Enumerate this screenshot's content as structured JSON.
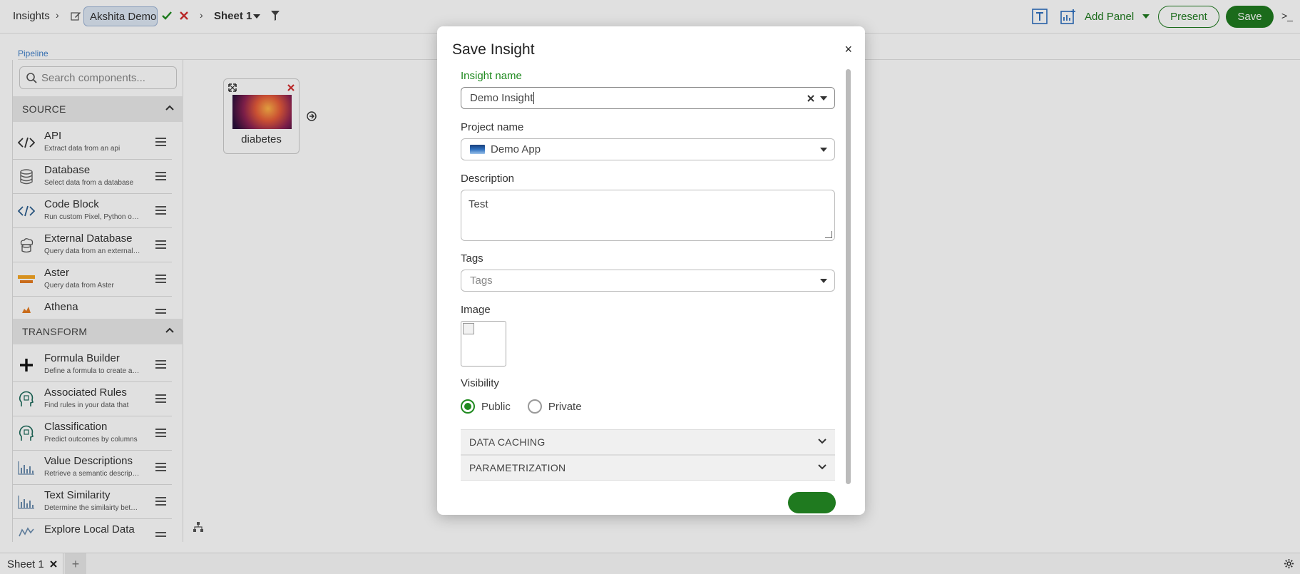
{
  "topbar": {
    "breadcrumb_root": "Insights",
    "insight_name_value": "Akshita Demo",
    "sheet_label": "Sheet 1",
    "add_panel_label": "Add Panel",
    "present_label": "Present",
    "save_label": "Save",
    "terminal_label": ">_"
  },
  "left": {
    "pipeline_label": "Pipeline",
    "search_placeholder": "Search components...",
    "source_header": "SOURCE",
    "transform_header": "TRANSFORM",
    "source_items": [
      {
        "title": "API",
        "desc": "Extract data from an api",
        "icon": "code-icon"
      },
      {
        "title": "Database",
        "desc": "Select data from a database",
        "icon": "database-icon"
      },
      {
        "title": "Code Block",
        "desc": "Run custom Pixel, Python or R",
        "icon": "code-icon"
      },
      {
        "title": "External Database",
        "desc": "Query data from an external database",
        "icon": "cloud-database-icon"
      },
      {
        "title": "Aster",
        "desc": "Query data from Aster",
        "icon": "aster-logo-icon"
      },
      {
        "title": "Athena",
        "desc": "",
        "icon": "athena-logo-icon"
      }
    ],
    "transform_items": [
      {
        "title": "Formula Builder",
        "desc": "Define a formula to create a column",
        "icon": "plus-icon"
      },
      {
        "title": "Associated Rules",
        "desc": "Find rules in your data that",
        "icon": "brain-icon"
      },
      {
        "title": "Classification",
        "desc": "Predict outcomes by columns",
        "icon": "brain-icon"
      },
      {
        "title": "Value Descriptions",
        "desc": "Retrieve a semantic description",
        "icon": "chart-icon"
      },
      {
        "title": "Text Similarity",
        "desc": "Determine the similairty between",
        "icon": "chart-icon"
      },
      {
        "title": "Explore Local Data",
        "desc": "",
        "icon": "chart-icon"
      }
    ]
  },
  "canvas": {
    "card_name": "diabetes"
  },
  "modal": {
    "title": "Save Insight",
    "close": "×",
    "insight_name_label": "Insight name",
    "insight_name_value": "Demo Insight",
    "project_name_label": "Project name",
    "project_name_value": "Demo App",
    "description_label": "Description",
    "description_value": "Test",
    "tags_label": "Tags",
    "tags_placeholder": "Tags",
    "image_label": "Image",
    "visibility_label": "Visibility",
    "visibility_options": [
      "Public",
      "Private"
    ],
    "visibility_selected": "Public",
    "accordion_data_caching": "DATA CACHING",
    "accordion_parametrization": "PARAMETRIZATION"
  },
  "bottom": {
    "sheet_tab": "Sheet 1",
    "add_sheet": "+"
  },
  "colors": {
    "brand_green": "#1f7a1f",
    "link_blue": "#3f7fc9"
  }
}
